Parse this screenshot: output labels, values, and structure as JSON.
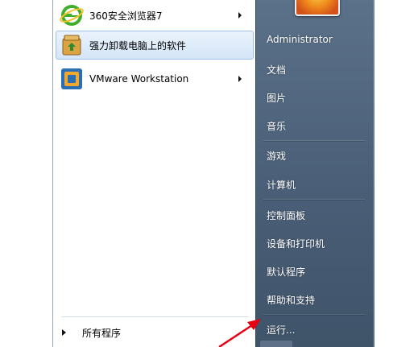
{
  "programs": [
    {
      "label": "360安全浏览器7",
      "icon": "360-browser-icon",
      "has_submenu": true,
      "selected": false
    },
    {
      "label": "强力卸载电脑上的软件",
      "icon": "uninstaller-icon",
      "has_submenu": false,
      "selected": true
    },
    {
      "label": "VMware Workstation",
      "icon": "vmware-icon",
      "has_submenu": true,
      "selected": false
    }
  ],
  "all_programs": {
    "label": "所有程序"
  },
  "right_pane": {
    "user": "Administrator",
    "items": [
      "文档",
      "图片",
      "音乐",
      "游戏",
      "计算机",
      "控制面板",
      "设备和打印机",
      "默认程序",
      "帮助和支持",
      "运行..."
    ]
  },
  "colors": {
    "right_pane": "#4a5f77",
    "selection": "#d4e5f8",
    "annotation_arrow": "#e60012"
  }
}
